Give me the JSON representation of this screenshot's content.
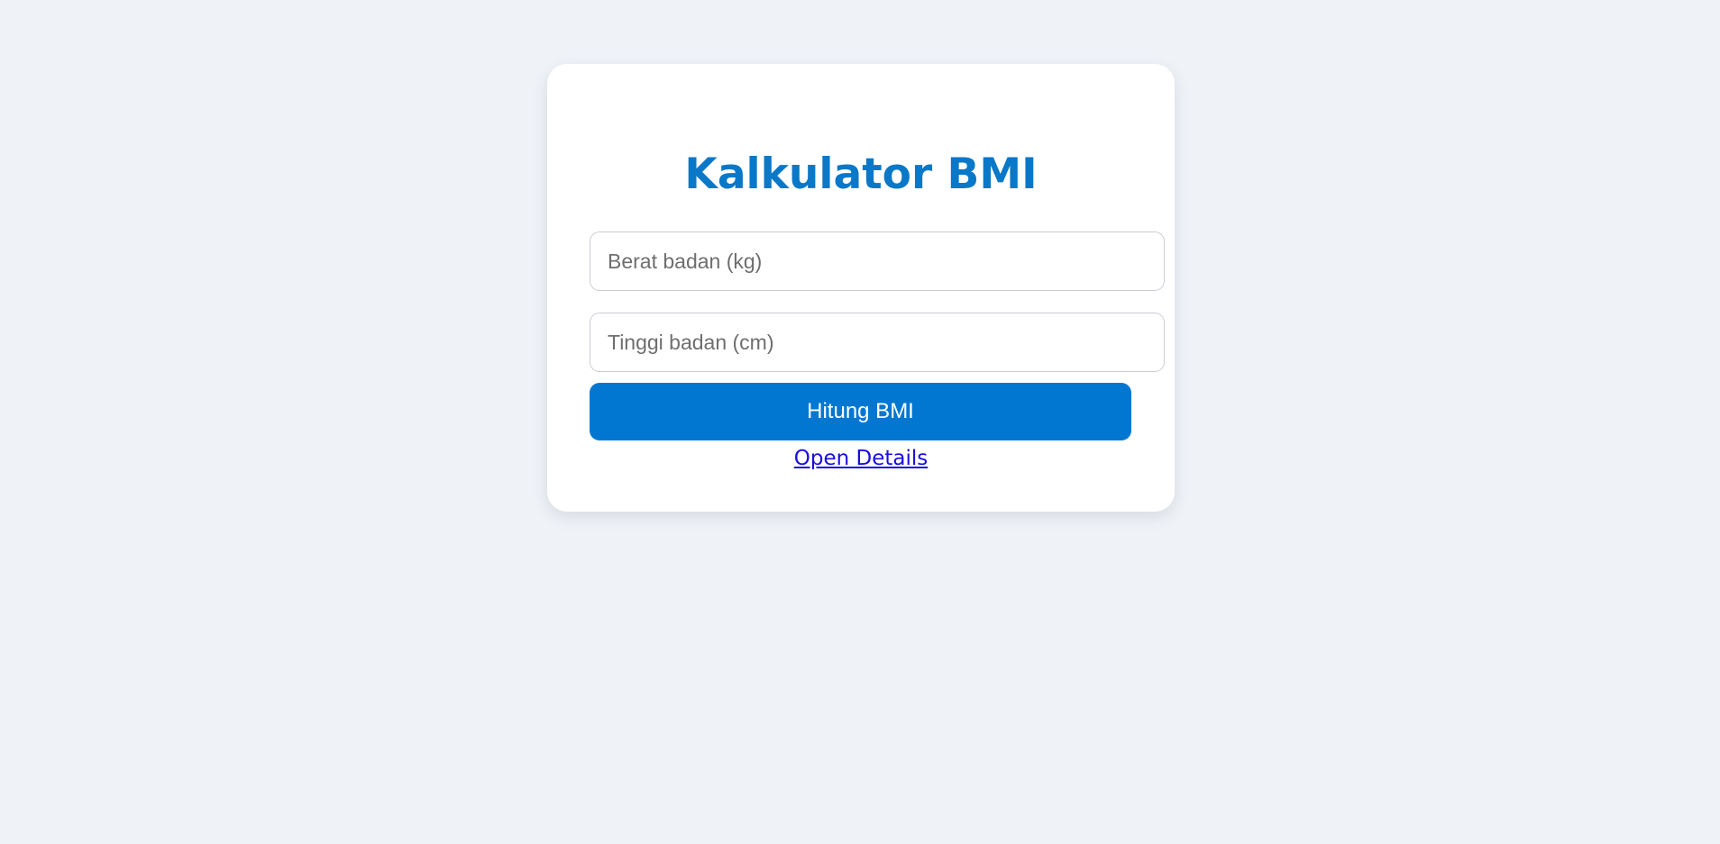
{
  "page": {
    "background_color": "#eff3f8"
  },
  "card": {
    "title": "Kalkulator BMI",
    "title_color": "#0a78c8",
    "weight_input": {
      "value": "",
      "placeholder": "Berat badan (kg)"
    },
    "height_input": {
      "value": "",
      "placeholder": "Tinggi badan (cm)"
    },
    "calculate_button": {
      "label": "Hitung BMI",
      "color": "#0177d1"
    },
    "details_link": {
      "label": "Open Details",
      "color": "#1a0dde"
    }
  }
}
